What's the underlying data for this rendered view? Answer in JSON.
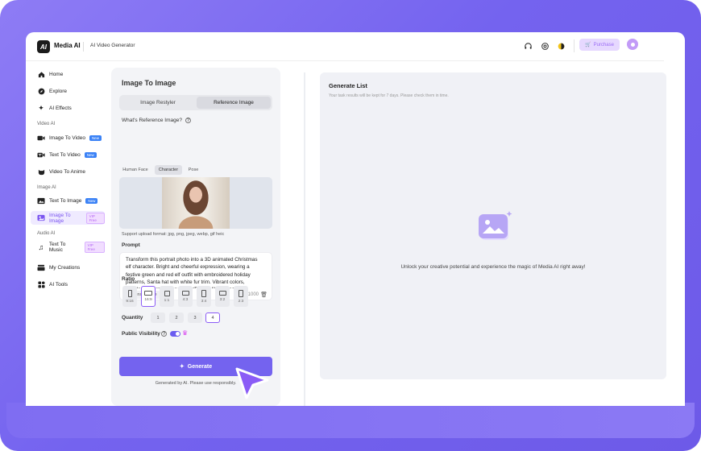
{
  "app": {
    "logo_mark": "AI",
    "name": "Media AI",
    "subtitle": "AI Video Generator"
  },
  "header": {
    "purchase_label": "Purchase"
  },
  "sidebar": {
    "items": [
      {
        "label": "Home",
        "icon": "home-icon"
      },
      {
        "label": "Explore",
        "icon": "compass-icon"
      },
      {
        "label": "AI Effects",
        "icon": "sparkle-icon"
      }
    ],
    "video_section": "Video AI",
    "video_items": [
      {
        "label": "Image To Video",
        "tag": "New"
      },
      {
        "label": "Text To Video",
        "tag": "New"
      },
      {
        "label": "Video To Anime",
        "tag": ""
      }
    ],
    "image_section": "Image AI",
    "image_items": [
      {
        "label": "Text To Image",
        "tag": "New"
      },
      {
        "label": "Image To Image",
        "tag": "VIP Free"
      }
    ],
    "audio_section": "Audio AI",
    "audio_items": [
      {
        "label": "Text To Music",
        "tag": "VIP Free"
      }
    ],
    "bottom_items": [
      {
        "label": "My Creations"
      },
      {
        "label": "AI Tools"
      }
    ]
  },
  "panel": {
    "title": "Image To Image",
    "tabs": [
      "Image Restyler",
      "Reference Image"
    ],
    "active_tab": "Reference Image",
    "ref_question": "What's Reference Image?",
    "ref_types": [
      "Human Face",
      "Character",
      "Pose"
    ],
    "active_ref_type": "Character",
    "support_text": "Support upload format: jpg, png, jpeg, webp, gif heic",
    "prompt_label": "Prompt",
    "prompt_text": "Transform this portrait photo into a 3D animated Christmas elf character. Bright and cheerful expression, wearing a festive green and red elf outfit with embroidered holiday patterns, Santa hat with white fur trim. Vibrant colors, detailed texture, stylized Pixar/Disney-like animation",
    "inspire_label": "Inspire me",
    "char_count": "379/1000",
    "ratio_label": "Ratio",
    "ratios": [
      "9:16",
      "16:9",
      "1:1",
      "4:3",
      "3:4",
      "3:2",
      "2:3"
    ],
    "active_ratio": "16:9",
    "quantity_label": "Quantity",
    "quantities": [
      "1",
      "2",
      "3",
      "4"
    ],
    "active_quantity": "4",
    "visibility_label": "Public Visibility",
    "visibility_on": true,
    "generate_label": "Generate",
    "generate_note": "Generated by AI. Please use responsibly."
  },
  "generate_list": {
    "title": "Generate List",
    "subtitle": "Your task results will be kept for 7 days. Please check them in time.",
    "empty_text": "Unlock your creative potential and experience the magic of Media AI right away!"
  },
  "colors": {
    "accent": "#7463ef",
    "frame": "#7b69f0",
    "vip": "#b465f5",
    "new_tag": "#3b82f6"
  }
}
